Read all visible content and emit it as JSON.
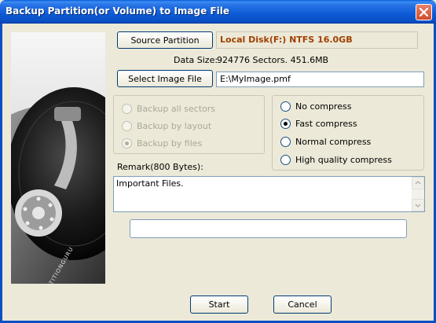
{
  "window": {
    "title": "Backup Partition(or Volume) to Image File"
  },
  "source": {
    "button_label": "Source Partition",
    "value": "Local Disk(F:) NTFS 16.0GB"
  },
  "data_size": {
    "label": "Data Size:",
    "value": "924776 Sectors. 451.6MB"
  },
  "image_file": {
    "button_label": "Select Image File",
    "value": "E:\\MyImage.pmf"
  },
  "backup_mode": {
    "options": [
      "Backup all sectors",
      "Backup by layout",
      "Backup by files"
    ],
    "selected": "Backup by files",
    "enabled": false
  },
  "compression": {
    "options": [
      "No compress",
      "Fast compress",
      "Normal compress",
      "High quality compress"
    ],
    "selected": "Fast compress"
  },
  "remark": {
    "label": "Remark(800 Bytes):",
    "value": "Important Files."
  },
  "progress": {
    "value": 0
  },
  "buttons": {
    "start": "Start",
    "cancel": "Cancel"
  },
  "side_image": {
    "brand_text": "PARTITIONGURU",
    "icon": "hard-disk-drive"
  }
}
